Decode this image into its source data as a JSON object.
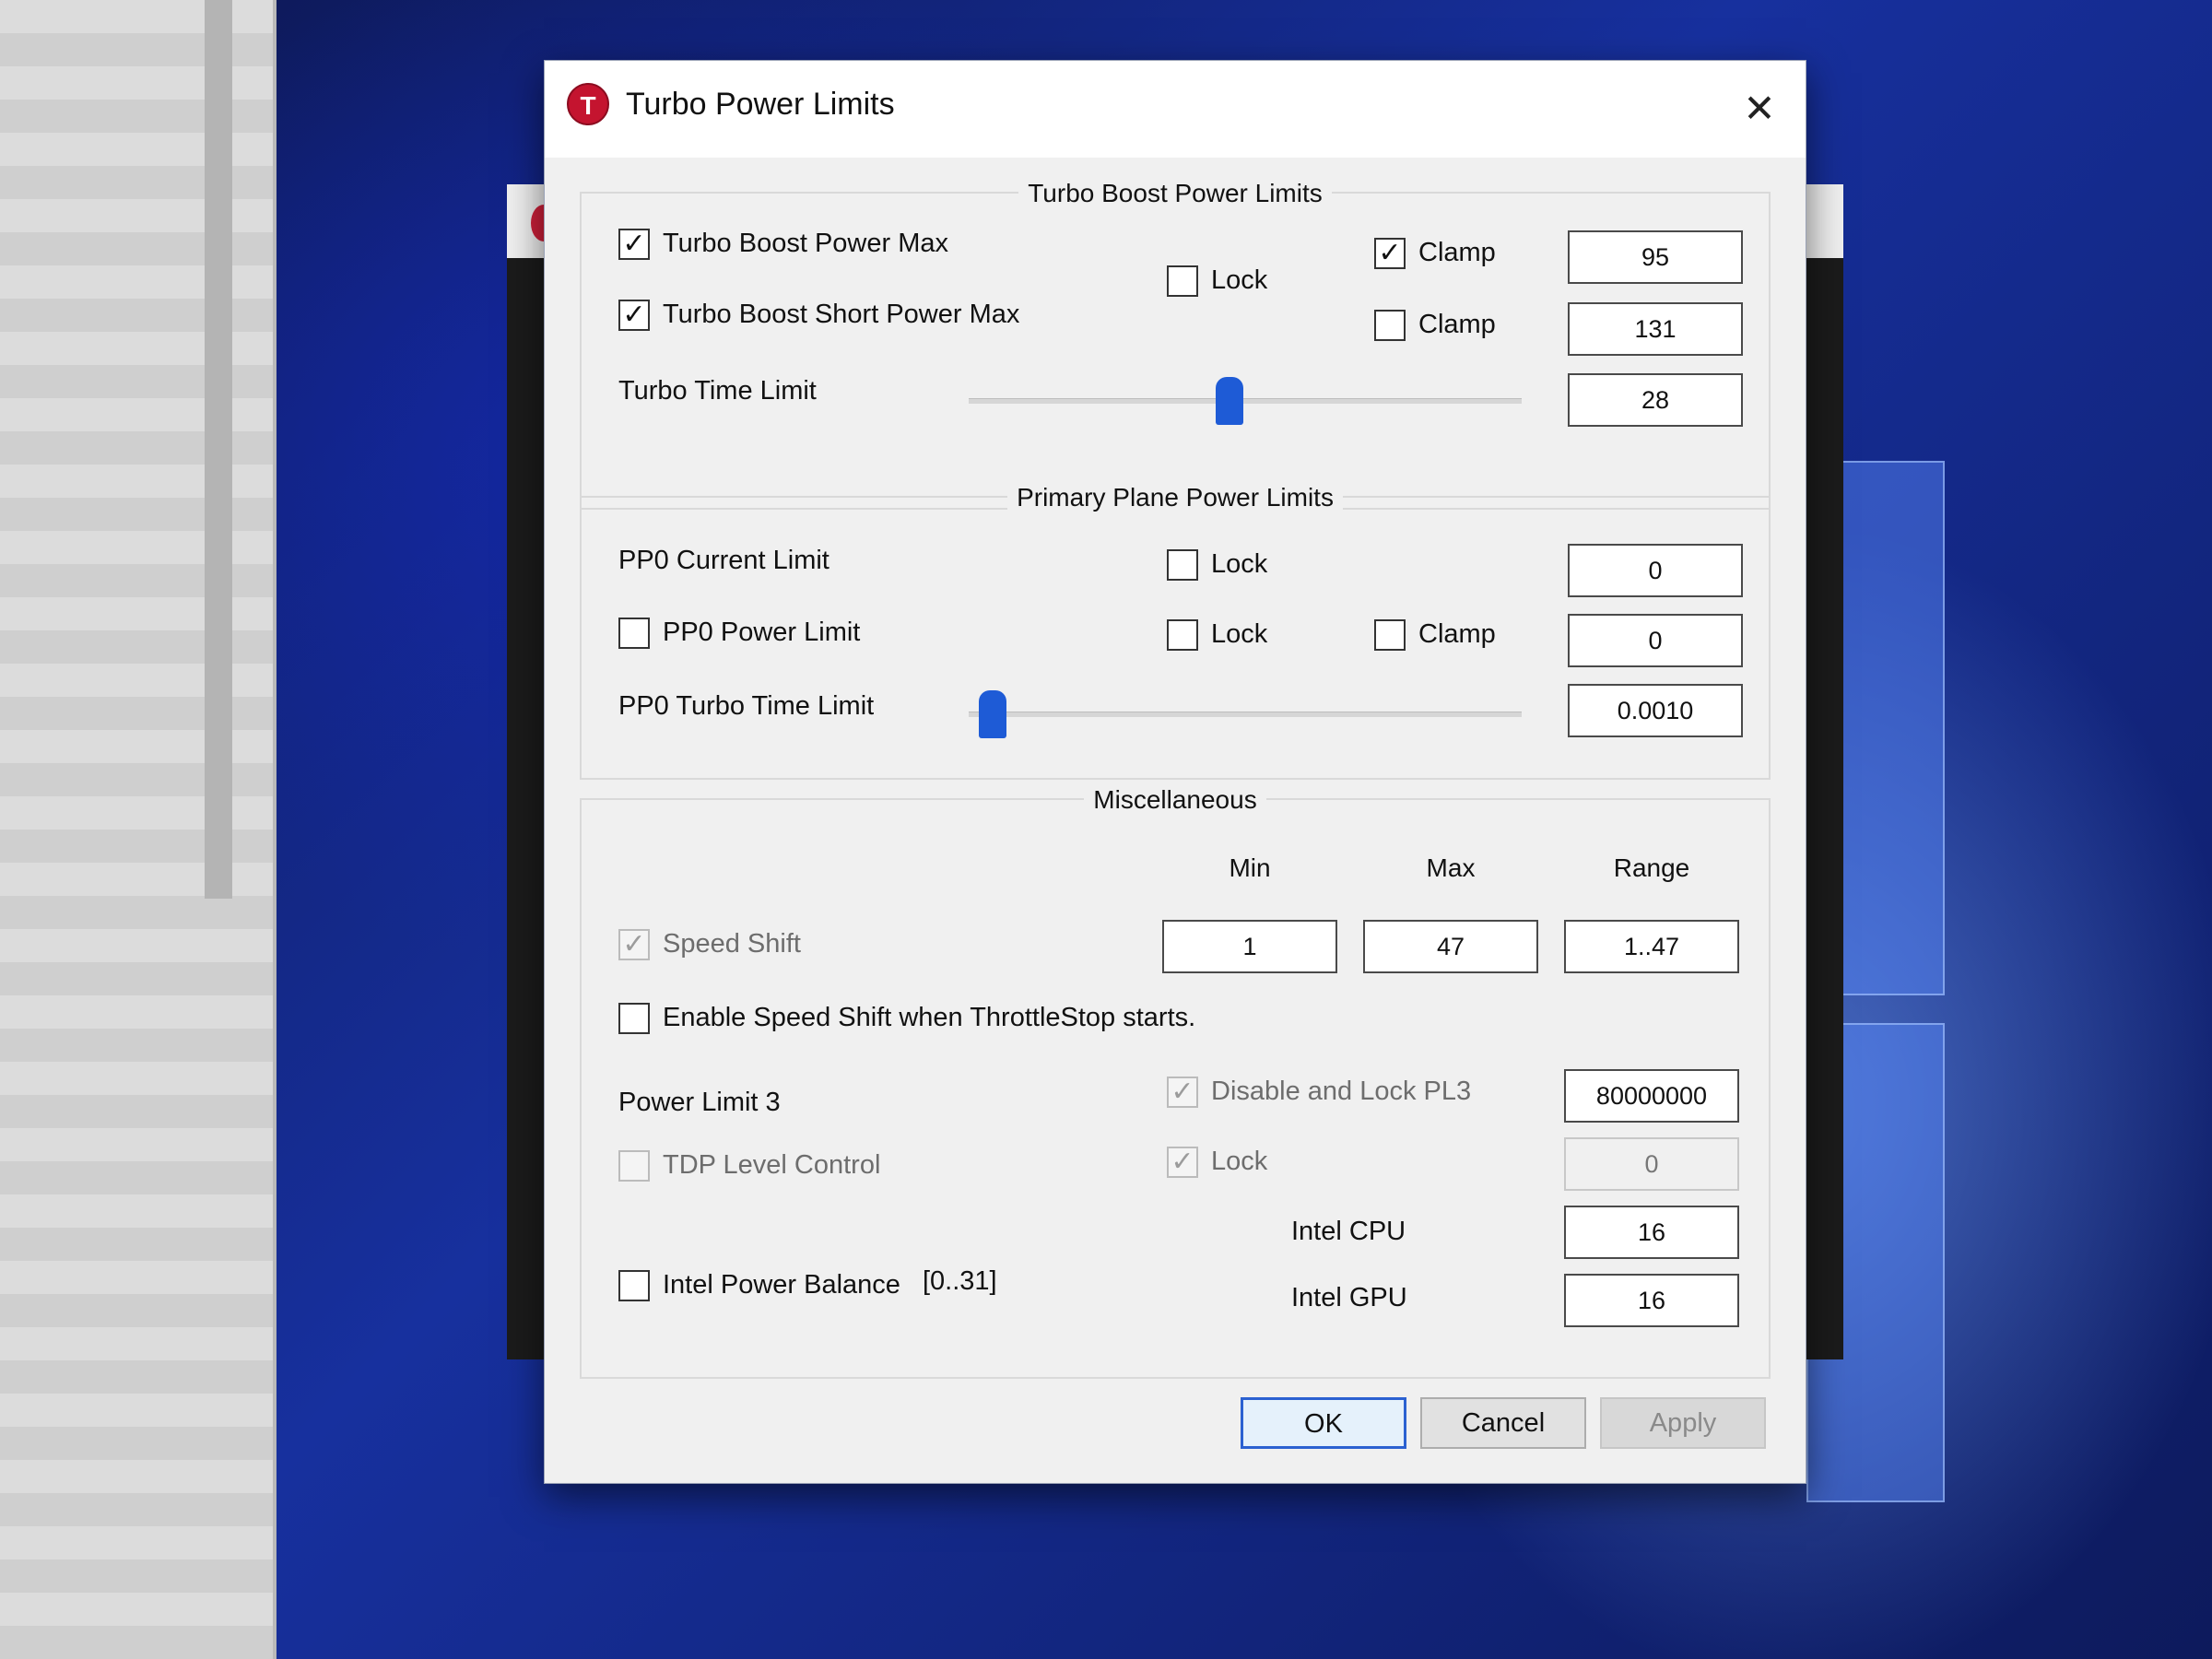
{
  "window": {
    "title": "Turbo Power Limits",
    "icon_letter": "T"
  },
  "turbo_boost": {
    "title": "Turbo Boost Power Limits",
    "power_max": {
      "label": "Turbo Boost Power Max",
      "checked": true
    },
    "short_power_max": {
      "label": "Turbo Boost Short Power Max",
      "checked": true
    },
    "lock": {
      "label": "Lock",
      "checked": false
    },
    "clamp_max": {
      "label": "Clamp",
      "checked": true
    },
    "clamp_short": {
      "label": "Clamp",
      "checked": false
    },
    "power_max_value": "95",
    "short_power_max_value": "131",
    "time_limit": {
      "label": "Turbo Time Limit",
      "value": "28",
      "position": 0.47
    }
  },
  "primary_plane": {
    "title": "Primary Plane Power Limits",
    "current_limit": {
      "label": "PP0 Current Limit",
      "value": "0"
    },
    "current_lock": {
      "label": "Lock",
      "checked": false
    },
    "power_limit": {
      "label": "PP0 Power Limit",
      "checked": false,
      "value": "0"
    },
    "power_lock": {
      "label": "Lock",
      "checked": false
    },
    "power_clamp": {
      "label": "Clamp",
      "checked": false
    },
    "turbo_time_limit": {
      "label": "PP0 Turbo Time Limit",
      "value": "0.0010",
      "position": 0.02
    }
  },
  "misc": {
    "title": "Miscellaneous",
    "col_min": "Min",
    "col_max": "Max",
    "col_range": "Range",
    "speed_shift": {
      "label": "Speed Shift",
      "checked": true,
      "enabled": false
    },
    "min_value": "1",
    "max_value": "47",
    "range_value": "1..47",
    "enable_speed_shift": {
      "label": "Enable Speed Shift when ThrottleStop starts.",
      "checked": false
    },
    "power_limit_3": {
      "label": "Power Limit 3"
    },
    "disable_lock_pl3": {
      "label": "Disable and Lock PL3",
      "checked": true,
      "enabled": false
    },
    "pl3_value": "80000000",
    "tdp_level_control": {
      "label": "TDP Level Control",
      "checked": false,
      "enabled": false
    },
    "tdp_lock": {
      "label": "Lock",
      "checked": true,
      "enabled": false
    },
    "tdp_value": "0",
    "intel_power_balance": {
      "label": "Intel Power Balance",
      "range": "[0..31]",
      "checked": false
    },
    "intel_cpu": {
      "label": "Intel CPU",
      "value": "16"
    },
    "intel_gpu": {
      "label": "Intel GPU",
      "value": "16"
    }
  },
  "buttons": {
    "ok": "OK",
    "cancel": "Cancel",
    "apply": "Apply"
  },
  "colors": {
    "accent": "#1e5bd6",
    "app_icon": "#c4142f",
    "dialog_bg": "#f0f0f0"
  }
}
